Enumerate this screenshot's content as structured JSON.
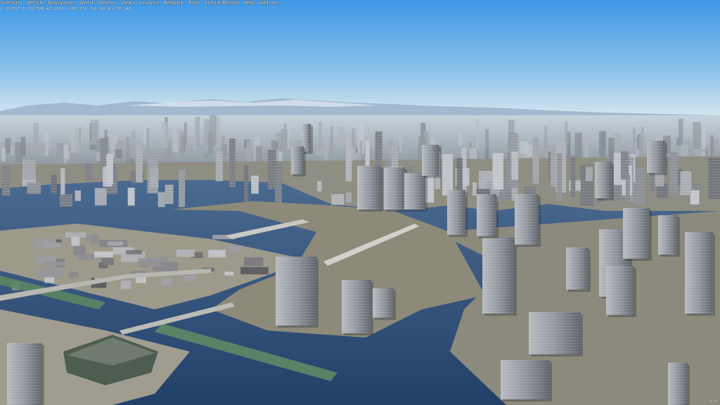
{
  "menubar": {
    "items": [
      "Scenario",
      "Vehicle",
      "Navigation",
      "World",
      "Options",
      "Views",
      "Analysis",
      "Network",
      "Tools",
      "Virtual Reality",
      "Help",
      "Add-ons"
    ]
  },
  "hud": {
    "text": "L 35.6517 E 139.7748 ALT 2634 ft  HDG 314°  IAS 142 kts  TAS 148"
  },
  "watermark": {
    "text": "SLPK"
  },
  "colors": {
    "sky_top": "#3f9ae8",
    "sky_horizon": "#d3e4f0",
    "water": "#2f4f79",
    "land": "#8f8c7e"
  }
}
